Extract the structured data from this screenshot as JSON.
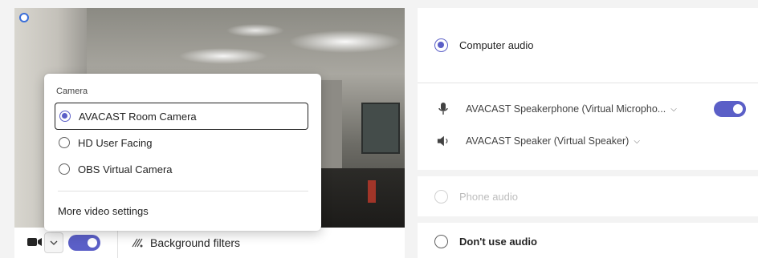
{
  "camera_menu": {
    "heading": "Camera",
    "options": [
      {
        "label": "AVACAST Room Camera",
        "selected": true
      },
      {
        "label": "HD User Facing",
        "selected": false
      },
      {
        "label": "OBS Virtual Camera",
        "selected": false
      }
    ],
    "more_settings": "More video settings"
  },
  "video_toolbar": {
    "camera_icon": "video-camera-icon",
    "chevron_icon": "chevron-down-icon",
    "video_on": true,
    "background_filters_label": "Background filters",
    "background_filters_icon": "sparkle-filter-icon"
  },
  "audio": {
    "computer_audio": {
      "label": "Computer audio",
      "selected": true
    },
    "microphone": {
      "label": "AVACAST Speakerphone (Virtual Micropho...",
      "icon": "microphone-icon",
      "enabled": true
    },
    "speaker": {
      "label": "AVACAST Speaker (Virtual Speaker)",
      "icon": "speaker-icon"
    },
    "phone_audio": {
      "label": "Phone audio",
      "disabled": true
    },
    "no_audio": {
      "label": "Don't use audio",
      "selected": false
    }
  },
  "colors": {
    "accent": "#5b5fc7",
    "background": "#f3f3f3",
    "card": "#ffffff"
  }
}
